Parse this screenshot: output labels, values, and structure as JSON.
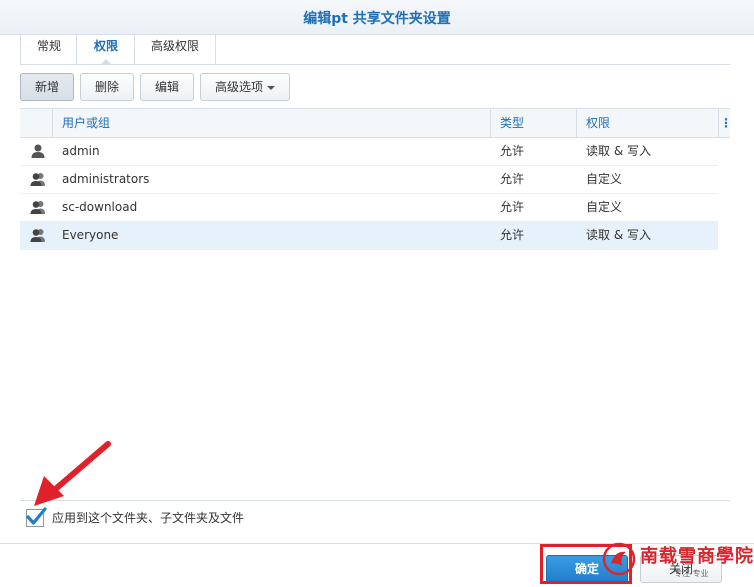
{
  "window": {
    "title": "编辑pt 共享文件夹设置"
  },
  "tabs": [
    {
      "label": "常规",
      "active": false
    },
    {
      "label": "权限",
      "active": true
    },
    {
      "label": "高级权限",
      "active": false
    }
  ],
  "toolbar": {
    "add_label": "新增",
    "delete_label": "删除",
    "edit_label": "编辑",
    "advanced_label": "高级选项"
  },
  "grid": {
    "columns": [
      "用户或组",
      "类型",
      "权限"
    ],
    "rows": [
      {
        "name": "admin",
        "kind": "user",
        "type": "允许",
        "permission": "读取 & 写入",
        "selected": false
      },
      {
        "name": "administrators",
        "kind": "group",
        "type": "允许",
        "permission": "自定义",
        "selected": false
      },
      {
        "name": "sc-download",
        "kind": "group",
        "type": "允许",
        "permission": "自定义",
        "selected": false
      },
      {
        "name": "Everyone",
        "kind": "group",
        "type": "允许",
        "permission": "读取 & 写入",
        "selected": true
      }
    ]
  },
  "apply_option": {
    "label": "应用到这个文件夹、子文件夹及文件",
    "checked": true
  },
  "footer": {
    "ok_label": "确定",
    "close_label": "关闭"
  },
  "watermark": {
    "text": "南载雪商學院",
    "sub": "专注 专业"
  },
  "colors": {
    "accent": "#1f6fb5",
    "highlight": "#e0202a",
    "selected_row": "#e6f1fb"
  }
}
